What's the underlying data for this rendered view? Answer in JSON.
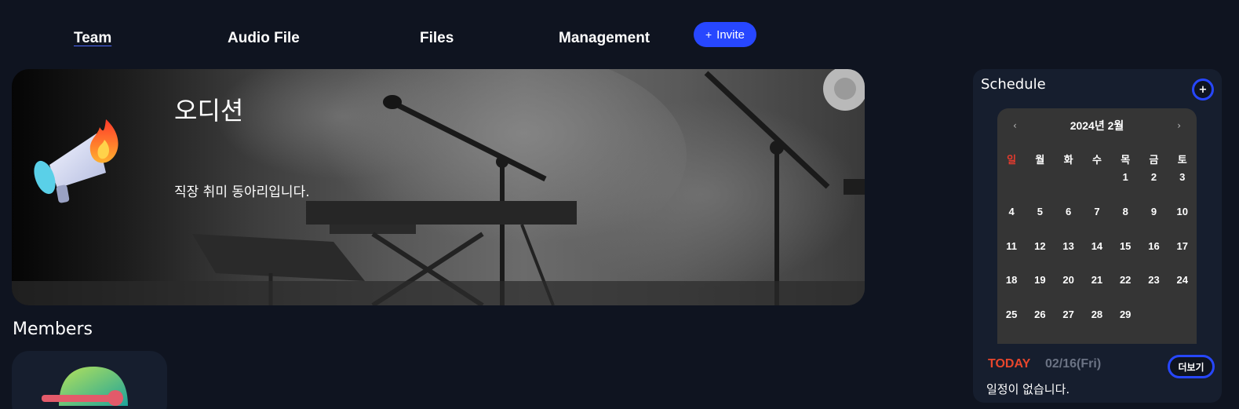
{
  "nav": {
    "items": [
      {
        "label": "Team",
        "active": true
      },
      {
        "label": "Audio File",
        "active": false
      },
      {
        "label": "Files",
        "active": false
      },
      {
        "label": "Management",
        "active": false
      }
    ],
    "invite": {
      "icon": "plus-icon",
      "label": "Invite"
    }
  },
  "hero": {
    "title": "오디션",
    "description": "직장 취미 동아리입니다.",
    "icon": "megaphone-fire-icon"
  },
  "members": {
    "title": "Members",
    "avatar_icon": "cap-avatar-icon"
  },
  "schedule": {
    "title": "Schedule",
    "add_label": "+",
    "calendar": {
      "month_label": "2024년 2월",
      "prev": "‹",
      "next": "›",
      "weekdays": [
        "일",
        "월",
        "화",
        "수",
        "목",
        "금",
        "토"
      ],
      "first_weekday_index": 4,
      "days": [
        "1",
        "2",
        "3",
        "4",
        "5",
        "6",
        "7",
        "8",
        "9",
        "10",
        "11",
        "12",
        "13",
        "14",
        "15",
        "16",
        "17",
        "18",
        "19",
        "20",
        "21",
        "22",
        "23",
        "24",
        "25",
        "26",
        "27",
        "28",
        "29"
      ]
    },
    "today_label": "TODAY",
    "today_date": "02/16(Fri)",
    "more_label": "더보기",
    "empty_text": "일정이 없습니다."
  },
  "colors": {
    "background": "#0f1420",
    "accent": "#2747ff",
    "panel": "#161e2e",
    "today": "#e8462c",
    "sunday": "#e63b2e"
  }
}
